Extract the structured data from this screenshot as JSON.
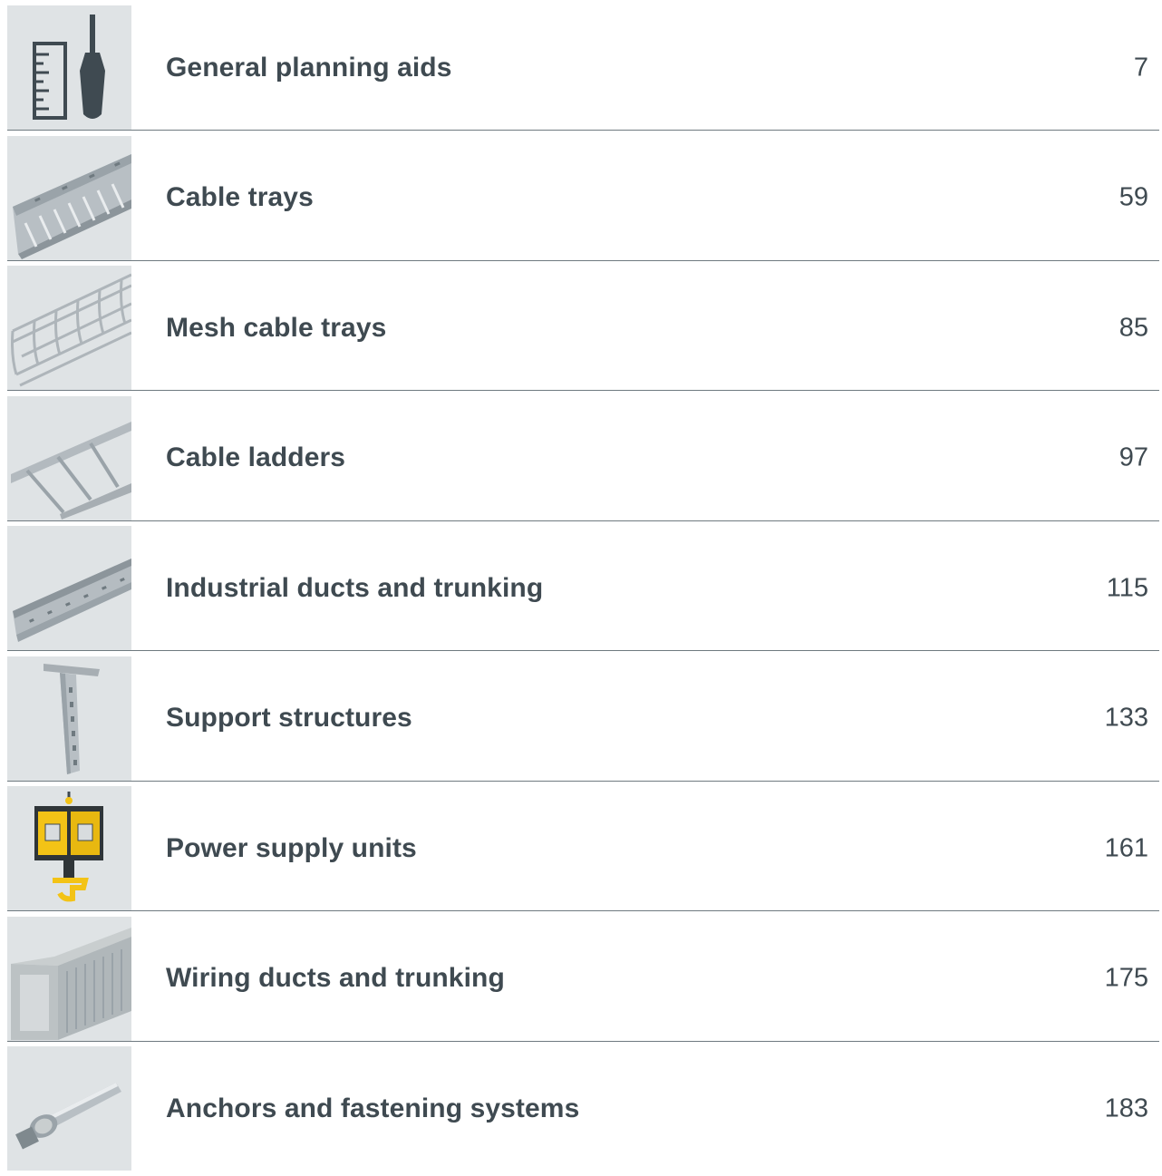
{
  "toc": {
    "entries": [
      {
        "title": "General planning aids",
        "page": "7",
        "icon": "ruler-screwdriver-icon"
      },
      {
        "title": "Cable trays",
        "page": "59",
        "icon": "cable-tray-icon"
      },
      {
        "title": "Mesh cable trays",
        "page": "85",
        "icon": "mesh-cable-tray-icon"
      },
      {
        "title": "Cable ladders",
        "page": "97",
        "icon": "cable-ladder-icon"
      },
      {
        "title": "Industrial ducts and trunking",
        "page": "115",
        "icon": "industrial-duct-icon"
      },
      {
        "title": "Support structures",
        "page": "133",
        "icon": "support-structure-icon"
      },
      {
        "title": "Power supply units",
        "page": "161",
        "icon": "power-supply-unit-icon"
      },
      {
        "title": "Wiring ducts and trunking",
        "page": "175",
        "icon": "wiring-duct-icon"
      },
      {
        "title": "Anchors and fastening systems",
        "page": "183",
        "icon": "anchor-bolt-icon"
      }
    ]
  },
  "colors": {
    "text": "#3f4a51",
    "divider": "#6f7a80",
    "thumb_background": "#dfe3e5",
    "power_unit_yellow": "#f3c316"
  }
}
